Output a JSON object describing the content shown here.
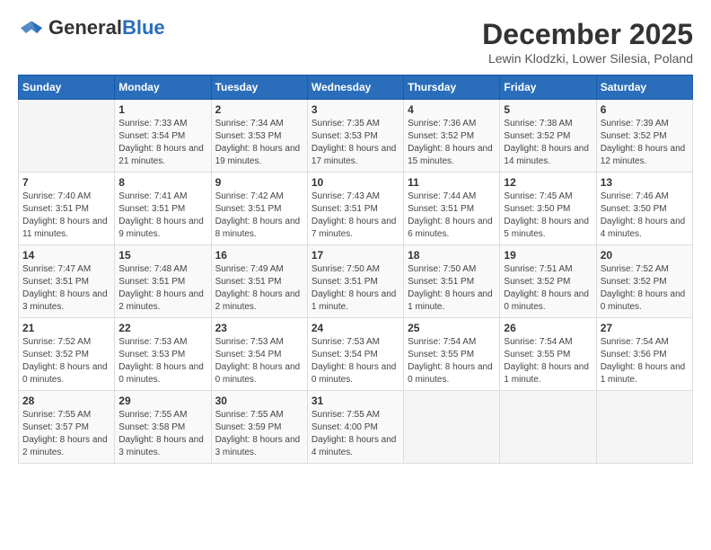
{
  "header": {
    "logo_general": "General",
    "logo_blue": "Blue",
    "month_title": "December 2025",
    "location": "Lewin Klodzki, Lower Silesia, Poland"
  },
  "calendar": {
    "days_of_week": [
      "Sunday",
      "Monday",
      "Tuesday",
      "Wednesday",
      "Thursday",
      "Friday",
      "Saturday"
    ],
    "weeks": [
      [
        {
          "day": "",
          "info": ""
        },
        {
          "day": "1",
          "info": "Sunrise: 7:33 AM\nSunset: 3:54 PM\nDaylight: 8 hours and 21 minutes."
        },
        {
          "day": "2",
          "info": "Sunrise: 7:34 AM\nSunset: 3:53 PM\nDaylight: 8 hours and 19 minutes."
        },
        {
          "day": "3",
          "info": "Sunrise: 7:35 AM\nSunset: 3:53 PM\nDaylight: 8 hours and 17 minutes."
        },
        {
          "day": "4",
          "info": "Sunrise: 7:36 AM\nSunset: 3:52 PM\nDaylight: 8 hours and 15 minutes."
        },
        {
          "day": "5",
          "info": "Sunrise: 7:38 AM\nSunset: 3:52 PM\nDaylight: 8 hours and 14 minutes."
        },
        {
          "day": "6",
          "info": "Sunrise: 7:39 AM\nSunset: 3:52 PM\nDaylight: 8 hours and 12 minutes."
        }
      ],
      [
        {
          "day": "7",
          "info": "Sunrise: 7:40 AM\nSunset: 3:51 PM\nDaylight: 8 hours and 11 minutes."
        },
        {
          "day": "8",
          "info": "Sunrise: 7:41 AM\nSunset: 3:51 PM\nDaylight: 8 hours and 9 minutes."
        },
        {
          "day": "9",
          "info": "Sunrise: 7:42 AM\nSunset: 3:51 PM\nDaylight: 8 hours and 8 minutes."
        },
        {
          "day": "10",
          "info": "Sunrise: 7:43 AM\nSunset: 3:51 PM\nDaylight: 8 hours and 7 minutes."
        },
        {
          "day": "11",
          "info": "Sunrise: 7:44 AM\nSunset: 3:51 PM\nDaylight: 8 hours and 6 minutes."
        },
        {
          "day": "12",
          "info": "Sunrise: 7:45 AM\nSunset: 3:50 PM\nDaylight: 8 hours and 5 minutes."
        },
        {
          "day": "13",
          "info": "Sunrise: 7:46 AM\nSunset: 3:50 PM\nDaylight: 8 hours and 4 minutes."
        }
      ],
      [
        {
          "day": "14",
          "info": "Sunrise: 7:47 AM\nSunset: 3:51 PM\nDaylight: 8 hours and 3 minutes."
        },
        {
          "day": "15",
          "info": "Sunrise: 7:48 AM\nSunset: 3:51 PM\nDaylight: 8 hours and 2 minutes."
        },
        {
          "day": "16",
          "info": "Sunrise: 7:49 AM\nSunset: 3:51 PM\nDaylight: 8 hours and 2 minutes."
        },
        {
          "day": "17",
          "info": "Sunrise: 7:50 AM\nSunset: 3:51 PM\nDaylight: 8 hours and 1 minute."
        },
        {
          "day": "18",
          "info": "Sunrise: 7:50 AM\nSunset: 3:51 PM\nDaylight: 8 hours and 1 minute."
        },
        {
          "day": "19",
          "info": "Sunrise: 7:51 AM\nSunset: 3:52 PM\nDaylight: 8 hours and 0 minutes."
        },
        {
          "day": "20",
          "info": "Sunrise: 7:52 AM\nSunset: 3:52 PM\nDaylight: 8 hours and 0 minutes."
        }
      ],
      [
        {
          "day": "21",
          "info": "Sunrise: 7:52 AM\nSunset: 3:52 PM\nDaylight: 8 hours and 0 minutes."
        },
        {
          "day": "22",
          "info": "Sunrise: 7:53 AM\nSunset: 3:53 PM\nDaylight: 8 hours and 0 minutes."
        },
        {
          "day": "23",
          "info": "Sunrise: 7:53 AM\nSunset: 3:54 PM\nDaylight: 8 hours and 0 minutes."
        },
        {
          "day": "24",
          "info": "Sunrise: 7:53 AM\nSunset: 3:54 PM\nDaylight: 8 hours and 0 minutes."
        },
        {
          "day": "25",
          "info": "Sunrise: 7:54 AM\nSunset: 3:55 PM\nDaylight: 8 hours and 0 minutes."
        },
        {
          "day": "26",
          "info": "Sunrise: 7:54 AM\nSunset: 3:55 PM\nDaylight: 8 hours and 1 minute."
        },
        {
          "day": "27",
          "info": "Sunrise: 7:54 AM\nSunset: 3:56 PM\nDaylight: 8 hours and 1 minute."
        }
      ],
      [
        {
          "day": "28",
          "info": "Sunrise: 7:55 AM\nSunset: 3:57 PM\nDaylight: 8 hours and 2 minutes."
        },
        {
          "day": "29",
          "info": "Sunrise: 7:55 AM\nSunset: 3:58 PM\nDaylight: 8 hours and 3 minutes."
        },
        {
          "day": "30",
          "info": "Sunrise: 7:55 AM\nSunset: 3:59 PM\nDaylight: 8 hours and 3 minutes."
        },
        {
          "day": "31",
          "info": "Sunrise: 7:55 AM\nSunset: 4:00 PM\nDaylight: 8 hours and 4 minutes."
        },
        {
          "day": "",
          "info": ""
        },
        {
          "day": "",
          "info": ""
        },
        {
          "day": "",
          "info": ""
        }
      ]
    ]
  }
}
